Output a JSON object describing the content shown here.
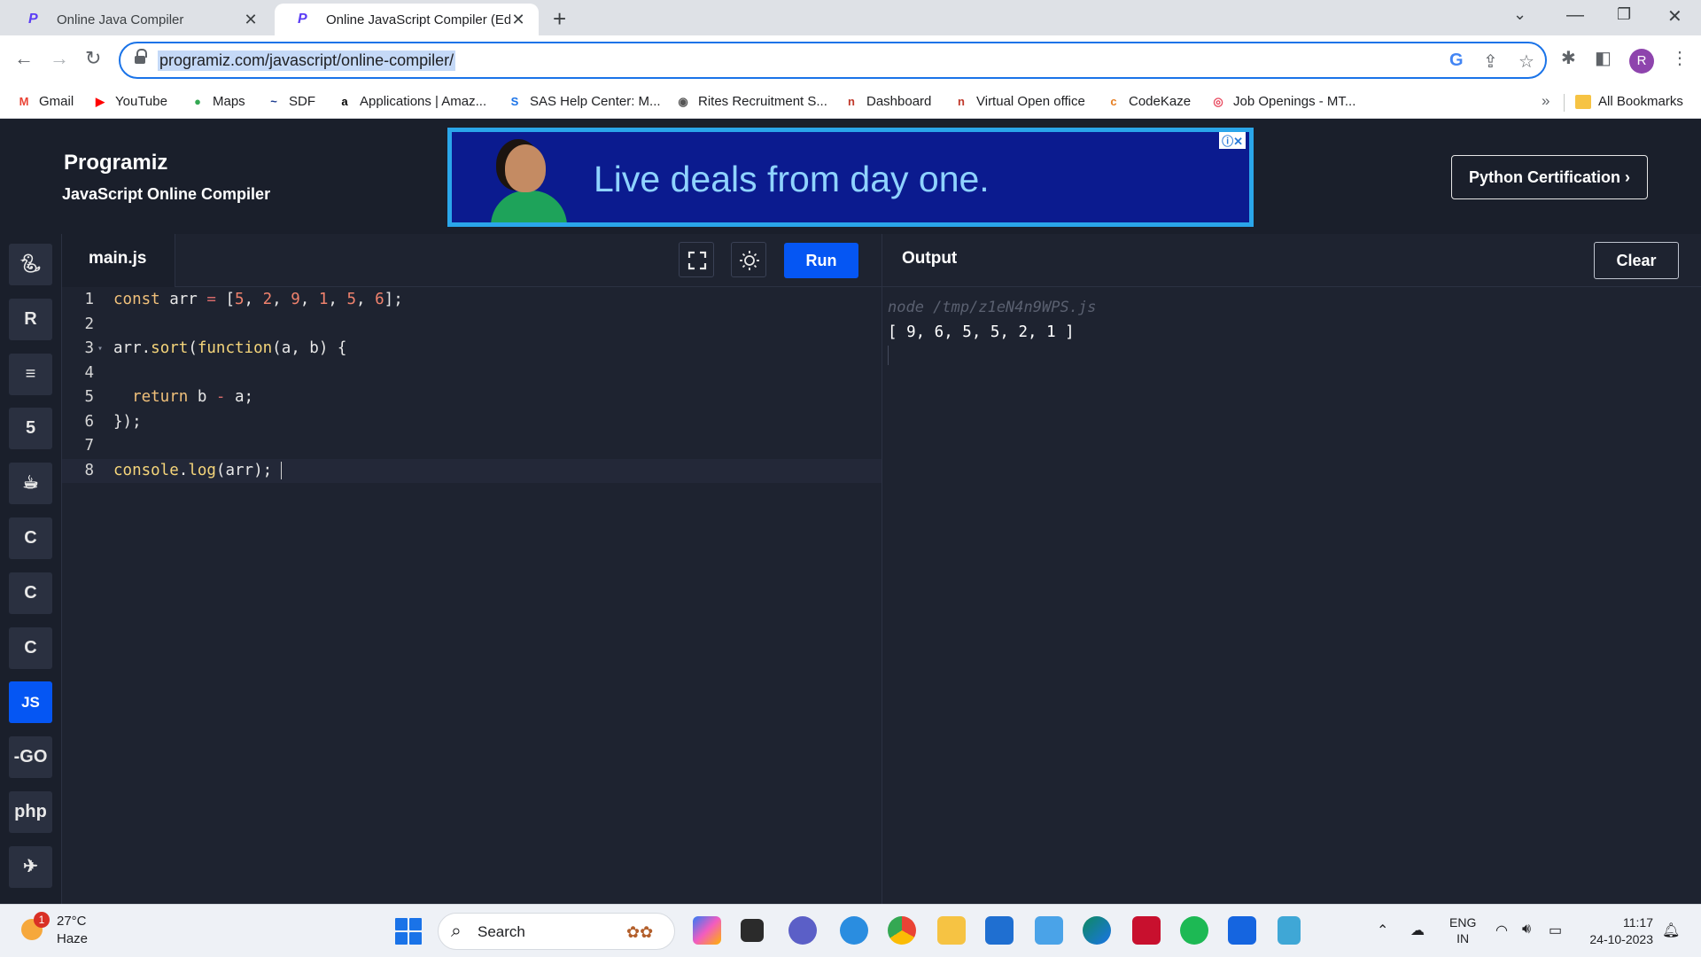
{
  "browser": {
    "tabs": [
      {
        "title": "Online Java Compiler",
        "favicon": "P"
      },
      {
        "title": "Online JavaScript Compiler (Edit",
        "favicon": "P"
      }
    ],
    "new_tab_label": "+",
    "url": "programiz.com/javascript/online-compiler/",
    "profile_initial": "R",
    "bookmarks": [
      {
        "label": "Gmail",
        "icon": "M",
        "color": "#ea4335"
      },
      {
        "label": "YouTube",
        "icon": "▶",
        "color": "#ff0000"
      },
      {
        "label": "Maps",
        "icon": "●",
        "color": "#34a853"
      },
      {
        "label": "SDF",
        "icon": "~",
        "color": "#1a3a8f"
      },
      {
        "label": "Applications | Amaz...",
        "icon": "a",
        "color": "#000000"
      },
      {
        "label": "SAS Help Center: M...",
        "icon": "S",
        "color": "#1a73e8"
      },
      {
        "label": "Rites Recruitment S...",
        "icon": "◉",
        "color": "#555555"
      },
      {
        "label": "Dashboard",
        "icon": "n",
        "color": "#c0392b"
      },
      {
        "label": "Virtual Open office",
        "icon": "n",
        "color": "#c0392b"
      },
      {
        "label": "CodeKaze",
        "icon": "c",
        "color": "#e67e22"
      },
      {
        "label": "Job Openings - MT...",
        "icon": "◎",
        "color": "#e84a5f"
      }
    ],
    "more_bookmarks": "»",
    "all_bookmarks": "All Bookmarks"
  },
  "site": {
    "logo": "Programiz",
    "subtitle": "JavaScript Online Compiler",
    "ad_text": "Live deals from day one.",
    "ad_badge": "ⓘ✕",
    "cert_button": "Python Certification ›"
  },
  "sidebar": {
    "languages": [
      {
        "name": "python",
        "glyph": "🐍︎",
        "active": false
      },
      {
        "name": "r",
        "glyph": "R",
        "active": false
      },
      {
        "name": "sql",
        "glyph": "≡",
        "active": false
      },
      {
        "name": "html",
        "glyph": "5",
        "active": false
      },
      {
        "name": "java",
        "glyph": "☕︎",
        "active": false
      },
      {
        "name": "c",
        "glyph": "C",
        "active": false
      },
      {
        "name": "cpp",
        "glyph": "C",
        "active": false
      },
      {
        "name": "csharp",
        "glyph": "C",
        "active": false
      },
      {
        "name": "javascript",
        "glyph": "JS",
        "active": true
      },
      {
        "name": "go",
        "glyph": "-GO",
        "active": false
      },
      {
        "name": "php",
        "glyph": "php",
        "active": false
      },
      {
        "name": "swift",
        "glyph": "✈︎",
        "active": false
      }
    ]
  },
  "editor": {
    "filename": "main.js",
    "run_label": "Run",
    "lines": [
      {
        "no": "1",
        "html": "<span class=\"kw\">const</span> arr <span class=\"op\">=</span> [<span class=\"num\">5</span>, <span class=\"num\">2</span>, <span class=\"num\">9</span>, <span class=\"num\">1</span>, <span class=\"num\">5</span>, <span class=\"num\">6</span>];"
      },
      {
        "no": "2",
        "html": ""
      },
      {
        "no": "3",
        "html": "arr.<span class=\"fn\">sort</span>(<span class=\"fn\">function</span>(a, b) {",
        "fold": true
      },
      {
        "no": "4",
        "html": ""
      },
      {
        "no": "5",
        "html": "  <span class=\"kw\">return</span> b <span class=\"op\">-</span> a;"
      },
      {
        "no": "6",
        "html": "});"
      },
      {
        "no": "7",
        "html": ""
      },
      {
        "no": "8",
        "html": "<span class=\"fn\">console</span>.<span class=\"fn\">log</span>(arr);",
        "current": true
      }
    ]
  },
  "output": {
    "title": "Output",
    "clear_label": "Clear",
    "command": "node /tmp/z1eN4n9WPS.js",
    "result": "[ 9, 6, 5, 5, 2, 1 ]"
  },
  "taskbar": {
    "weather_badge": "1",
    "temperature": "27°C",
    "condition": "Haze",
    "search_placeholder": "Search",
    "language_line1": "ENG",
    "language_line2": "IN",
    "time": "11:17",
    "date": "24-10-2023"
  }
}
